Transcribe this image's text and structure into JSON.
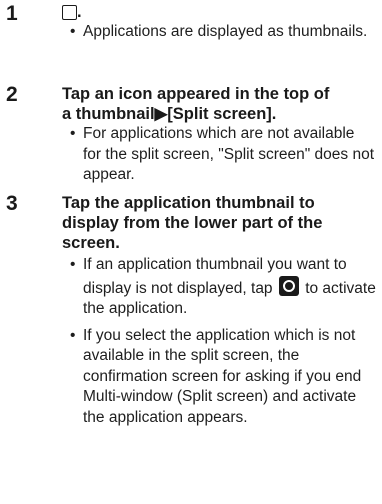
{
  "steps": [
    {
      "number": "1",
      "title_suffix": ".",
      "title_icon": "recent-apps-square-icon",
      "bullets": [
        "Applications are displayed as thumbnails."
      ]
    },
    {
      "number": "2",
      "title_lines": [
        "Tap an icon appeared in the top of",
        "a thumbnail▶[Split screen]."
      ],
      "bullets": [
        "For applications which are not available for the split screen, \"Split screen\" does not appear."
      ]
    },
    {
      "number": "3",
      "title_lines": [
        "Tap the application thumbnail to",
        "display from the lower part of the",
        "screen."
      ],
      "bullet_1_before_icon": "If an application thumbnail you want to display is not displayed, tap",
      "bullet_1_icon": "home-circle-icon",
      "bullet_1_after_icon": "to activate the application.",
      "bullet_2": "If you select the application which is not available in the split screen, the confirmation screen for asking if you end Multi-window (Split screen) and activate the application appears."
    }
  ],
  "bullet_char": "•"
}
